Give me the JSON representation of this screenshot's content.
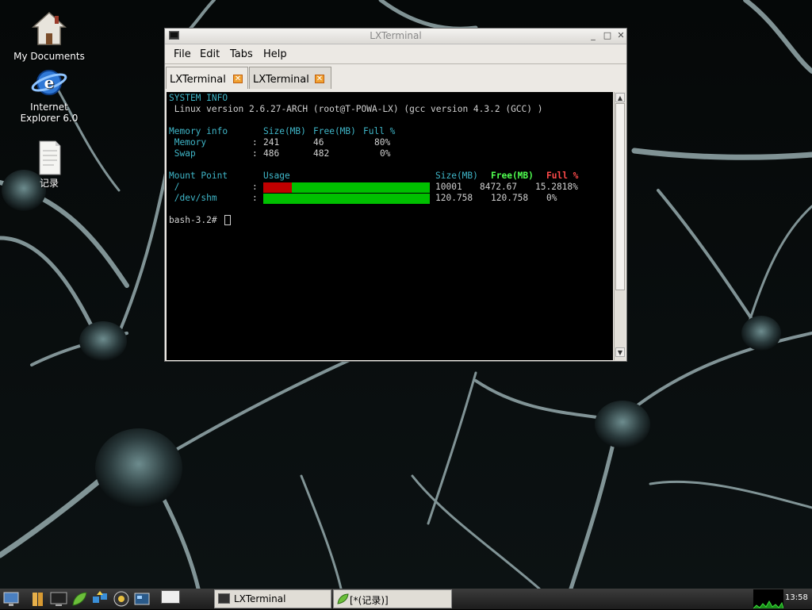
{
  "desktop": {
    "icons": [
      {
        "label": "My Documents",
        "icon": "home-icon"
      },
      {
        "label": "Internet\nExplorer 6.0",
        "icon": "internet-explorer-icon"
      },
      {
        "label": "记录",
        "icon": "text-file-icon"
      }
    ]
  },
  "window": {
    "title": "LXTerminal",
    "buttons": {
      "minimize": "_",
      "maximize": "□",
      "close": "✕"
    },
    "menu": [
      "File",
      "Edit",
      "Tabs",
      "Help"
    ],
    "tabs": [
      {
        "label": "LXTerminal",
        "close": "✕",
        "active": true
      },
      {
        "label": "LXTerminal",
        "close": "✕",
        "active": false
      }
    ]
  },
  "terminal": {
    "system_info_header": "SYSTEM INFO",
    "linux_version": " Linux version 2.6.27-ARCH (root@T-POWA-LX) (gcc version 4.3.2 (GCC) )",
    "memory_header": {
      "label": "Memory info",
      "size": "Size(MB)",
      "free": "Free(MB)",
      "full": "Full %"
    },
    "memory_rows": [
      {
        "name": " Memory",
        "sep": ":",
        "size": "241",
        "free": "46",
        "full": "80%"
      },
      {
        "name": " Swap",
        "sep": ":",
        "size": "486",
        "free": "482",
        "full": "0%"
      }
    ],
    "mount_header": {
      "label": "Mount Point",
      "usage": "Usage",
      "size": "Size(MB)",
      "free": "Free(MB)",
      "full": "Full %"
    },
    "mount_rows": [
      {
        "name": " /",
        "sep": ":",
        "used_fraction": 0.17,
        "size": "10001",
        "free": "8472.67",
        "full": "15.2818%"
      },
      {
        "name": " /dev/shm",
        "sep": ":",
        "used_fraction": 0.0,
        "size": "120.758",
        "free": "120.758",
        "full": "0%"
      }
    ],
    "prompt": "bash-3.2#"
  },
  "taskbar": {
    "launchers": [
      "desktop-icon",
      "file-manager-icon",
      "terminal-monitor-icon",
      "leafpad-icon",
      "network-icon",
      "media-player-icon",
      "screen-icon"
    ],
    "tasks": [
      {
        "label": "LXTerminal",
        "icon": "terminal-icon"
      },
      {
        "label": "[*(记录)]",
        "icon": "leafpad-icon"
      }
    ],
    "clock": "13:58"
  },
  "colors": {
    "terminal_bg": "#000000",
    "cyan": "#3fb6c8",
    "bar_free": "#00c000",
    "bar_used": "#c00000",
    "free_label": "#50ff50",
    "full_label": "#ff4a4a"
  }
}
